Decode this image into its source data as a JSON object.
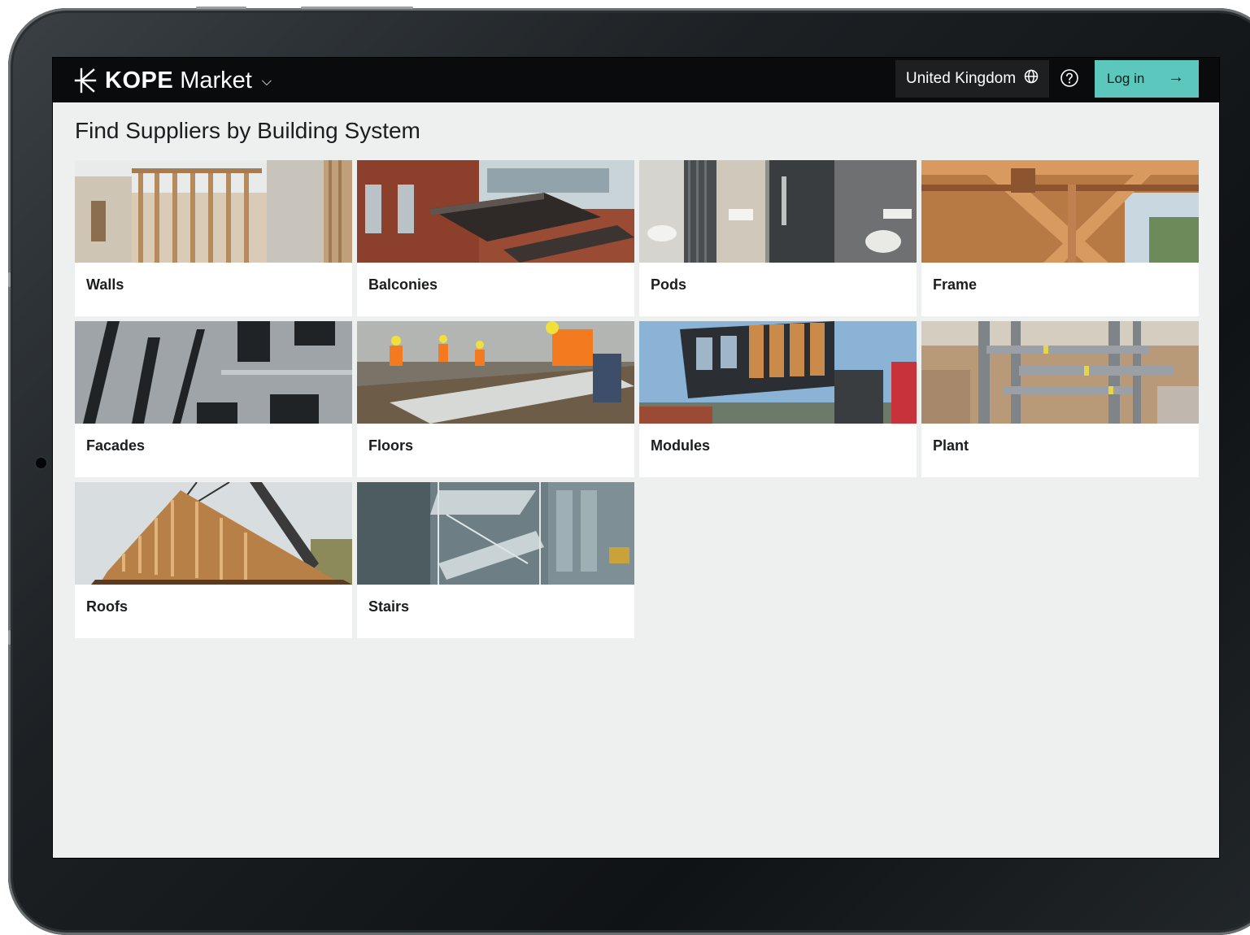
{
  "header": {
    "brand_name": "KOPE",
    "brand_product": "Market",
    "brand_chevron": "⌵",
    "region_label": "United Kingdom",
    "region_icon": "globe-icon",
    "help_icon": "help-circle-icon",
    "login_label": "Log in",
    "login_arrow": "→",
    "accent_color": "#5cc7bd"
  },
  "main": {
    "title": "Find Suppliers by Building System",
    "categories": [
      {
        "label": "Walls"
      },
      {
        "label": "Balconies"
      },
      {
        "label": "Pods"
      },
      {
        "label": "Frame"
      },
      {
        "label": "Facades"
      },
      {
        "label": "Floors"
      },
      {
        "label": "Modules"
      },
      {
        "label": "Plant"
      },
      {
        "label": "Roofs"
      },
      {
        "label": "Stairs"
      }
    ]
  }
}
